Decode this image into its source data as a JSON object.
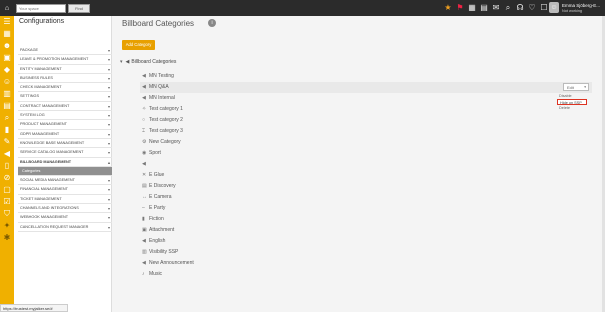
{
  "topbar": {
    "home_icon": "home-icon",
    "workspace_placeholder": "Your space",
    "find_label": "Find",
    "user_name": "Emma Sjöberg-E...",
    "user_sub": "Not working"
  },
  "config": {
    "title": "Configurations",
    "menu_items": [
      "PACKAGE",
      "LEAVE & PROMOTION MANAGEMENT",
      "ENTITY MANAGEMENT",
      "BUSINESS RULES",
      "CHECK MANAGEMENT",
      "SETTINGS",
      "CONTRACT MANAGEMENT",
      "SYSTEM LOG",
      "PRODUCT MANAGEMENT",
      "GDPR MANAGEMENT",
      "KNOWLEDGE BASE MANAGEMENT",
      "SERVICE CATALOG MANAGEMENT",
      "BILLBOARD MANAGEMENT",
      "Categories",
      "SOCIAL MEDIA MANAGEMENT",
      "FINANCIAL MANAGEMENT",
      "TICKET MANAGEMENT",
      "CHANNELS AND INTEGRATIONS",
      "WEBHOOK MANAGEMENT",
      "CANCELLATION REQUEST MANAGER"
    ]
  },
  "main": {
    "title": "Billboard Categories",
    "add_button": "Add Category",
    "root_label": "Billboard Categories",
    "items": [
      "MN Testing",
      "MN Q&A",
      "MN Internal",
      "Test category 1",
      "Test category 2",
      "Test category 3",
      "New Category",
      "Sport",
      "",
      "E Glue",
      "E Discovery",
      "E Camera",
      "E Party",
      "Fiction",
      "Attachment",
      "English",
      "Visibility SSP",
      "New Announcement",
      "Music"
    ],
    "context": {
      "edit_label": "Edit",
      "options": [
        "Disable",
        "Hide on SSP",
        "Delete"
      ]
    }
  },
  "status_url": "https://trustest.myjalker.se/#"
}
